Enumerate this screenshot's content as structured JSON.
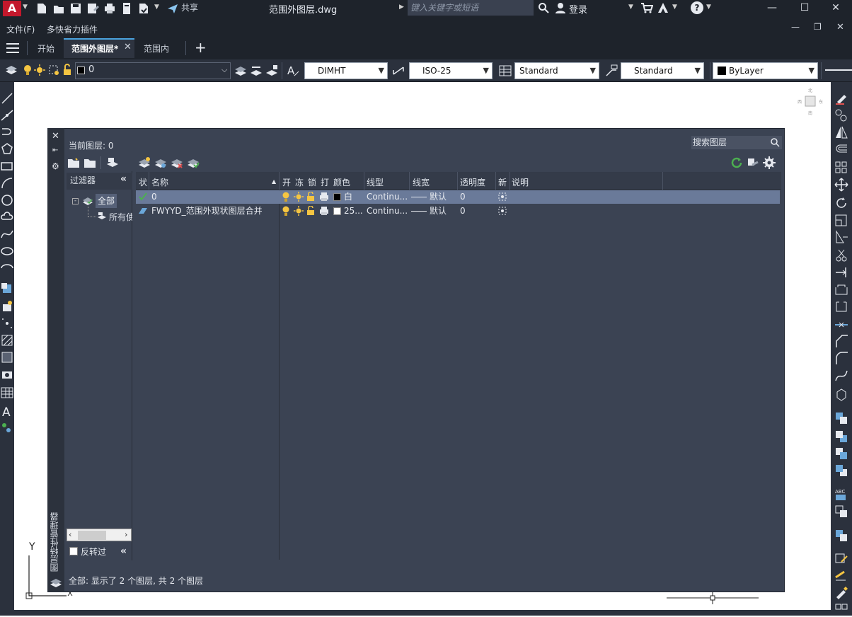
{
  "title_bar": {
    "app_logo": "A",
    "share_label": "共享",
    "document_title": "范围外图层.dwg",
    "search_placeholder": "键入关键字或短语",
    "login_label": "登录",
    "help_icon": "question-circle-icon"
  },
  "menu_bar": {
    "items": [
      "文件(F)",
      "多快省力插件"
    ]
  },
  "tabs": {
    "items": [
      {
        "label": "开始",
        "active": false
      },
      {
        "label": "范围外图层*",
        "active": true
      },
      {
        "label": "范围内",
        "active": false
      }
    ],
    "add_label": "+"
  },
  "ribbon": {
    "layer_combo": "0",
    "dim_style": "DIMHT",
    "text_style": "ISO-25",
    "table_style": "Standard",
    "mleader_style": "Standard",
    "color_combo": "ByLayer"
  },
  "layer_manager": {
    "vertical_title": "图层特性管理器",
    "current_layer": "当前图层: 0",
    "search_placeholder": "搜索图层",
    "filter_header": "过滤器",
    "filter_tree": {
      "root": "全部",
      "child": "所有使用的图层"
    },
    "invert_label": "反转过",
    "invert_checked": false,
    "columns": [
      "状",
      "名称",
      "开",
      "冻",
      "锁",
      "打",
      "颜色",
      "线型",
      "线宽",
      "透明度",
      "新",
      "说明"
    ],
    "layers": [
      {
        "status": "current",
        "name": "0",
        "color_name": "白",
        "swatch": "#000000",
        "linetype": "Continu...",
        "lineweight": "默认",
        "transparency": "0",
        "selected": true
      },
      {
        "status": "layer",
        "name": "FWYYD_范围外现状图层合并",
        "color_name": "25...",
        "swatch": "#ffffff",
        "linetype": "Continu...",
        "lineweight": "默认",
        "transparency": "0",
        "selected": false
      }
    ],
    "status_text": "全部: 显示了 2 个图层, 共 2 个图层"
  },
  "canvas": {
    "ucs_y_label": "Y"
  },
  "colors": {
    "accent": "#4aa3df",
    "app_red": "#c3182c",
    "panel_bg": "#3b4353",
    "selection": "#6a7a99"
  }
}
